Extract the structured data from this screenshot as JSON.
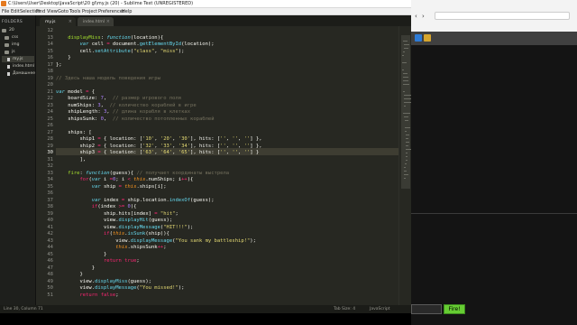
{
  "window": {
    "title": "C:\\Users\\User\\Desktop\\JavaScript\\20 gl\\my.js (20) - Sublime Text (UNREGISTERED)"
  },
  "menu": [
    "File",
    "Edit",
    "Selection",
    "Find",
    "View",
    "Goto",
    "Tools",
    "Project",
    "Preferences",
    "Help"
  ],
  "sidebar": {
    "header": "FOLDERS",
    "items": [
      {
        "label": "20",
        "type": "folder"
      },
      {
        "label": "css",
        "type": "folder"
      },
      {
        "label": "img",
        "type": "folder"
      },
      {
        "label": "js",
        "type": "folder"
      },
      {
        "label": "my.js",
        "type": "file",
        "active": true
      },
      {
        "label": "index.html",
        "type": "file"
      },
      {
        "label": "Домашнее з",
        "type": "file"
      }
    ]
  },
  "tabs": [
    {
      "label": "my.js",
      "active": true
    },
    {
      "label": "index.html",
      "active": false
    }
  ],
  "editor": {
    "current_line": 30,
    "lines": [
      {
        "n": 12,
        "t": ""
      },
      {
        "n": 13,
        "t": "    displayMiss: function(location){"
      },
      {
        "n": 14,
        "t": "        var cell = document.getElementById(location);"
      },
      {
        "n": 15,
        "t": "        cell.setAttribute(\"class\", \"miss\");"
      },
      {
        "n": 16,
        "t": "    }"
      },
      {
        "n": 17,
        "t": "};"
      },
      {
        "n": 18,
        "t": ""
      },
      {
        "n": 19,
        "t": "// Здесь наша модель поведения игры"
      },
      {
        "n": 20,
        "t": ""
      },
      {
        "n": 21,
        "t": "var model = {"
      },
      {
        "n": 22,
        "t": "    boardSize: 7,  // размер игрового поля"
      },
      {
        "n": 23,
        "t": "    numShips: 3,  // количество кораблей в игре"
      },
      {
        "n": 24,
        "t": "    shipLength: 3, // длина корабля в клетках"
      },
      {
        "n": 25,
        "t": "    shipsSunk: 0,  // количество потопленных кораблей"
      },
      {
        "n": 26,
        "t": ""
      },
      {
        "n": 27,
        "t": "    ships: ["
      },
      {
        "n": 28,
        "t": "        ship1 = { location: ['10', '20', '30'], hits: ['', '', ''] },"
      },
      {
        "n": 29,
        "t": "        ship2 = { location: ['32', '33', '34'], hits: ['', '', ''] },"
      },
      {
        "n": 30,
        "t": "        ship3 = { location: ['63', '64', '65'], hits: ['', '', ''] }"
      },
      {
        "n": 31,
        "t": "        ],"
      },
      {
        "n": 32,
        "t": ""
      },
      {
        "n": 33,
        "t": "    fire: function(guess){ // получает координаты выстрела"
      },
      {
        "n": 34,
        "t": "        for(var i =0; i < this.numShips; i++){"
      },
      {
        "n": 35,
        "t": "            var ship = this.ships[i];"
      },
      {
        "n": 36,
        "t": ""
      },
      {
        "n": 37,
        "t": "            var index = ship.location.indexOf(guess);"
      },
      {
        "n": 38,
        "t": "            if(index >= 0){"
      },
      {
        "n": 39,
        "t": "                ship.hits[index] = \"hit\";"
      },
      {
        "n": 40,
        "t": "                view.displayHit(guess);"
      },
      {
        "n": 41,
        "t": "                view.displayMessage(\"HIT!!!\");"
      },
      {
        "n": 42,
        "t": "                if(this.isSunk(ship)){"
      },
      {
        "n": 43,
        "t": "                    view.displayMessage(\"You sank my battleship!\");"
      },
      {
        "n": 44,
        "t": "                    this.shipsSunk++;"
      },
      {
        "n": 45,
        "t": "                }"
      },
      {
        "n": 46,
        "t": "                return true;"
      },
      {
        "n": 47,
        "t": "            }"
      },
      {
        "n": 48,
        "t": "        }"
      },
      {
        "n": 49,
        "t": "        view.displayMiss(guess);"
      },
      {
        "n": 50,
        "t": "        view.displayMessage(\"You missed!\");"
      },
      {
        "n": 51,
        "t": "        return false;"
      }
    ]
  },
  "status": {
    "left": "Line 30, Column 71",
    "tab_size": "Tab Size: 4",
    "syntax": "JavaScript"
  },
  "browser": {
    "fire_button": "Fire!",
    "input_value": ""
  },
  "colors": {
    "editor_bg": "#272822",
    "keyword": "#66d9ef",
    "operator": "#f92672",
    "function": "#a6e22e",
    "string": "#e6db74",
    "number": "#ae81ff",
    "comment": "#75715e",
    "fire_button": "#66cc33"
  }
}
